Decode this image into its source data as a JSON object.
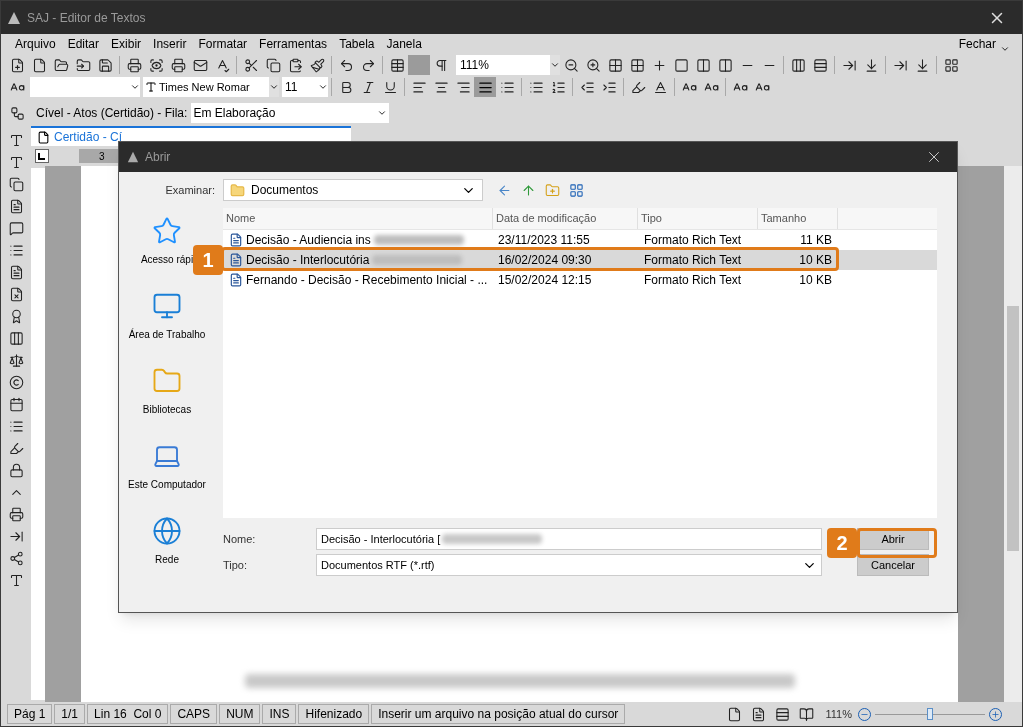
{
  "window": {
    "title": "SAJ - Editor de Textos"
  },
  "menu": {
    "items": [
      "Arquivo",
      "Editar",
      "Exibir",
      "Inserir",
      "Formatar",
      "Ferramentas",
      "Tabela",
      "Janela"
    ],
    "close_label": "Fechar"
  },
  "toolbar": {
    "zoom": "111%",
    "font_name": "Times New Romar",
    "font_size": "11"
  },
  "workflow": {
    "label": "Cível - Atos (Certidão) - Fila:",
    "queue": "Em Elaboração"
  },
  "document_tab": {
    "label": "Certidão - Cí"
  },
  "ruler": {
    "mark": "3"
  },
  "dialog": {
    "title": "Abrir",
    "look_in_label": "Examinar:",
    "look_in": "Documentos",
    "places": [
      {
        "label": "Acesso rápi",
        "kind": "star"
      },
      {
        "label": "Área de Trabalho",
        "kind": "desktop"
      },
      {
        "label": "Bibliotecas",
        "kind": "folder"
      },
      {
        "label": "Este Computador",
        "kind": "computer"
      },
      {
        "label": "Rede",
        "kind": "globe"
      }
    ],
    "columns": [
      "Nome",
      "Data de modificação",
      "Tipo",
      "Tamanho"
    ],
    "rows": [
      {
        "name": "Decisão - Audiencia ins",
        "blurred": true,
        "date": "23/11/2023 11:55",
        "type": "Formato Rich Text",
        "size": "11 KB",
        "selected": false
      },
      {
        "name": "Decisão - Interlocutória",
        "blurred": true,
        "date": "16/02/2024 09:30",
        "type": "Formato Rich Text",
        "size": "10 KB",
        "selected": true
      },
      {
        "name": "Fernando - Decisão - Recebimento Inicial - ...",
        "blurred": false,
        "date": "15/02/2024 12:15",
        "type": "Formato Rich Text",
        "size": "10 KB",
        "selected": false
      }
    ],
    "name_label": "Nome:",
    "name_value": "Decisão - Interlocutória [",
    "type_label": "Tipo:",
    "type_value": "Documentos RTF (*.rtf)",
    "buttons": [
      "Abrir",
      "Cancelar"
    ]
  },
  "callouts": [
    "1",
    "2"
  ],
  "status_bar": {
    "cells": [
      "Pág 1",
      "1/1",
      "Lin 16  Col 0",
      "CAPS",
      "NUM",
      "INS",
      "Hifenizado",
      "Inserir um arquivo na posição atual do cursor"
    ],
    "zoom": "111%",
    "zoom_slider": {
      "level": 0.5
    }
  }
}
